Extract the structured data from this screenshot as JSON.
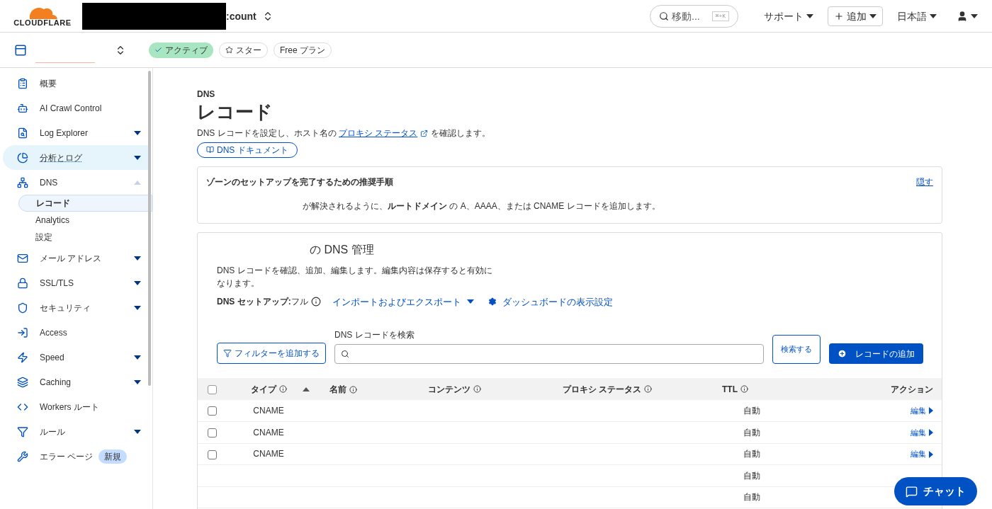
{
  "header": {
    "logo_text": "CLOUDFLARE",
    "account": ":count",
    "search": {
      "placeholder": "移動...",
      "shortcut": "⌘+K"
    },
    "menus": [
      {
        "label": "サポート",
        "kind": "text"
      },
      {
        "label": "追加",
        "kind": "add"
      },
      {
        "label": "日本語",
        "kind": "text"
      }
    ]
  },
  "zone_bar": {
    "badges": [
      {
        "label": "アクティブ",
        "kind": "status"
      },
      {
        "label": "スター",
        "kind": "star"
      },
      {
        "label": "Free プラン",
        "kind": "plan"
      }
    ]
  },
  "sidebar": {
    "items": [
      {
        "label": "概要",
        "selected": false
      },
      {
        "label": "AI Crawl Control",
        "selected": false
      },
      {
        "label": "Log Explorer",
        "selected": false,
        "expanded": false
      },
      {
        "label": "分析とログ",
        "selected": true,
        "expanded": false
      },
      {
        "label": "DNS",
        "selected": false,
        "expanded": true,
        "children": [
          {
            "label": "レコード",
            "selected": true
          },
          {
            "label": "Analytics",
            "selected": false
          },
          {
            "label": "設定",
            "selected": false
          }
        ]
      },
      {
        "label": "メール アドレス",
        "selected": false,
        "expanded": false
      },
      {
        "label": "SSL/TLS",
        "selected": false,
        "expanded": false
      },
      {
        "label": "セキュリティ",
        "selected": false,
        "expanded": false
      },
      {
        "label": "Access",
        "selected": false
      },
      {
        "label": "Speed",
        "selected": false,
        "expanded": false
      },
      {
        "label": "Caching",
        "selected": false,
        "expanded": false
      },
      {
        "label": "Workers ルート",
        "selected": false
      },
      {
        "label": "ルール",
        "selected": false,
        "expanded": false
      },
      {
        "label": "エラー ページ",
        "selected": false,
        "badge": "新規"
      }
    ]
  },
  "page": {
    "breadcrumb": "DNS",
    "title": "レコード",
    "description_before": "DNS レコードを設定し、ホスト名の",
    "description_link": "プロキシ ステータス",
    "description_after": "を確認します。",
    "docs_button": "DNS ドキュメント"
  },
  "setup_card": {
    "title": "ゾーンのセットアップを完了するための推奨手順",
    "hide_link": "隠す",
    "step": "が解決されるように、**ルートドメイン** の A、AAAA、または CNAME レコードを追加します。"
  },
  "dns_card": {
    "title": "の DNS 管理",
    "description": "DNS レコードを確認、追加、編集します。編集内容は保存すると有効になります。",
    "setup_label": "DNS セットアップ:",
    "setup_value": "フル",
    "import_export": "インポートおよびエクスポート",
    "dashboard_settings": "ダッシュボードの表示設定",
    "filter_button": "フィルターを追加する",
    "search_label": "DNS レコードを検索",
    "search_button": "検索する",
    "add_button": "レコードの追加"
  },
  "table": {
    "select_all_checked": false,
    "columns": [
      "タイプ",
      "名前",
      "コンテンツ",
      "プロキシ ステータス",
      "TTL",
      "アクション"
    ],
    "rows": [
      {
        "type": "CNAME",
        "ttl": "自動",
        "action": "編集",
        "checked": false
      },
      {
        "type": "CNAME",
        "ttl": "自動",
        "action": "編集",
        "checked": false
      },
      {
        "type": "CNAME",
        "ttl": "自動",
        "action": "編集",
        "checked": false
      },
      {
        "ttl": "自動"
      },
      {
        "ttl": "自動"
      }
    ]
  },
  "chat_button": "チャット"
}
